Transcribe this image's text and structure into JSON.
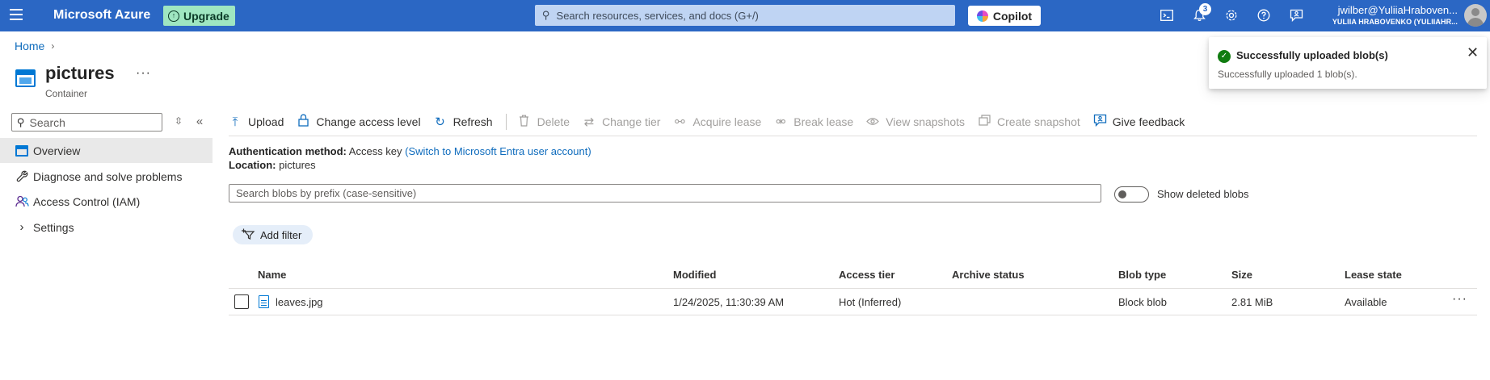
{
  "topbar": {
    "brand": "Microsoft Azure",
    "upgrade_label": "Upgrade",
    "search_placeholder": "Search resources, services, and docs (G+/)",
    "copilot_label": "Copilot",
    "notification_count": "3",
    "user_email": "jwilber@YuliiaHraboven...",
    "user_directory": "YULIIA HRABOVENKO (YULIIAHR...",
    "icons": [
      "cloud-shell-icon",
      "bell-icon",
      "gear-icon",
      "help-icon",
      "feedback-icon"
    ]
  },
  "breadcrumb": {
    "home": "Home"
  },
  "page": {
    "title": "pictures",
    "subtitle": "Container",
    "more": "···"
  },
  "nav": {
    "search_placeholder": "Search",
    "items": [
      {
        "label": "Overview",
        "icon": "overview-icon",
        "active": true
      },
      {
        "label": "Diagnose and solve problems",
        "icon": "wrench-icon"
      },
      {
        "label": "Access Control (IAM)",
        "icon": "people-icon"
      },
      {
        "label": "Settings",
        "icon": "chevron-right-icon"
      }
    ]
  },
  "toolbar": {
    "upload": "Upload",
    "change_access": "Change access level",
    "refresh": "Refresh",
    "delete": "Delete",
    "change_tier": "Change tier",
    "acquire_lease": "Acquire lease",
    "break_lease": "Break lease",
    "view_snapshots": "View snapshots",
    "create_snapshot": "Create snapshot",
    "give_feedback": "Give feedback"
  },
  "info": {
    "auth_label": "Authentication method:",
    "auth_value": "Access key",
    "auth_link": "(Switch to Microsoft Entra user account)",
    "location_label": "Location:",
    "location_value": "pictures"
  },
  "blob_search_placeholder": "Search blobs by prefix (case-sensitive)",
  "show_deleted_label": "Show deleted blobs",
  "add_filter_label": "Add filter",
  "table": {
    "headers": {
      "name": "Name",
      "modified": "Modified",
      "access_tier": "Access tier",
      "archive_status": "Archive status",
      "blob_type": "Blob type",
      "size": "Size",
      "lease_state": "Lease state"
    },
    "rows": [
      {
        "name": "leaves.jpg",
        "modified": "1/24/2025, 11:30:39 AM",
        "access_tier": "Hot (Inferred)",
        "archive_status": "",
        "blob_type": "Block blob",
        "size": "2.81 MiB",
        "lease_state": "Available"
      }
    ]
  },
  "toast": {
    "title": "Successfully uploaded blob(s)",
    "message": "Successfully uploaded 1 blob(s)."
  },
  "colors": {
    "topbar": "#2b67c4",
    "upgrade": "#9fe6c1",
    "link": "#0f6cbd",
    "success": "#107c10"
  }
}
